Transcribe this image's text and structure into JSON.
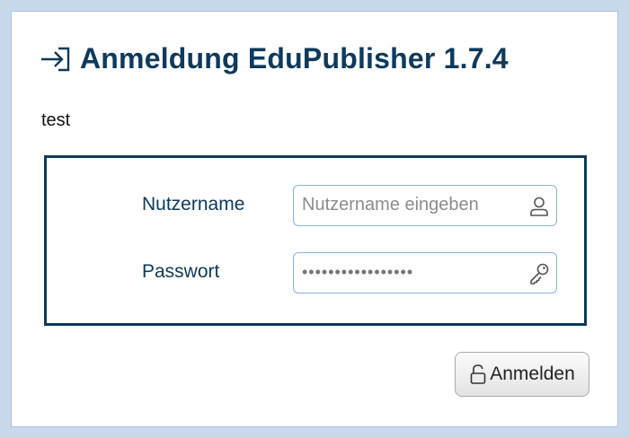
{
  "dialog": {
    "title": "Anmeldung EduPublisher 1.7.4",
    "title_icon": "login-arrow-icon",
    "subtitle": "test"
  },
  "form": {
    "username": {
      "label": "Nutzername",
      "placeholder": "Nutzername eingeben",
      "value": "",
      "icon": "user-icon"
    },
    "password": {
      "label": "Passwort",
      "value": "•••••••••••••••••",
      "icon": "key-icon"
    }
  },
  "submit": {
    "label": "Anmelden",
    "icon": "unlock-icon"
  },
  "colors": {
    "accent": "#0e3a5c",
    "field_border": "#8db3dd",
    "page_background": "#c9d9ec"
  }
}
